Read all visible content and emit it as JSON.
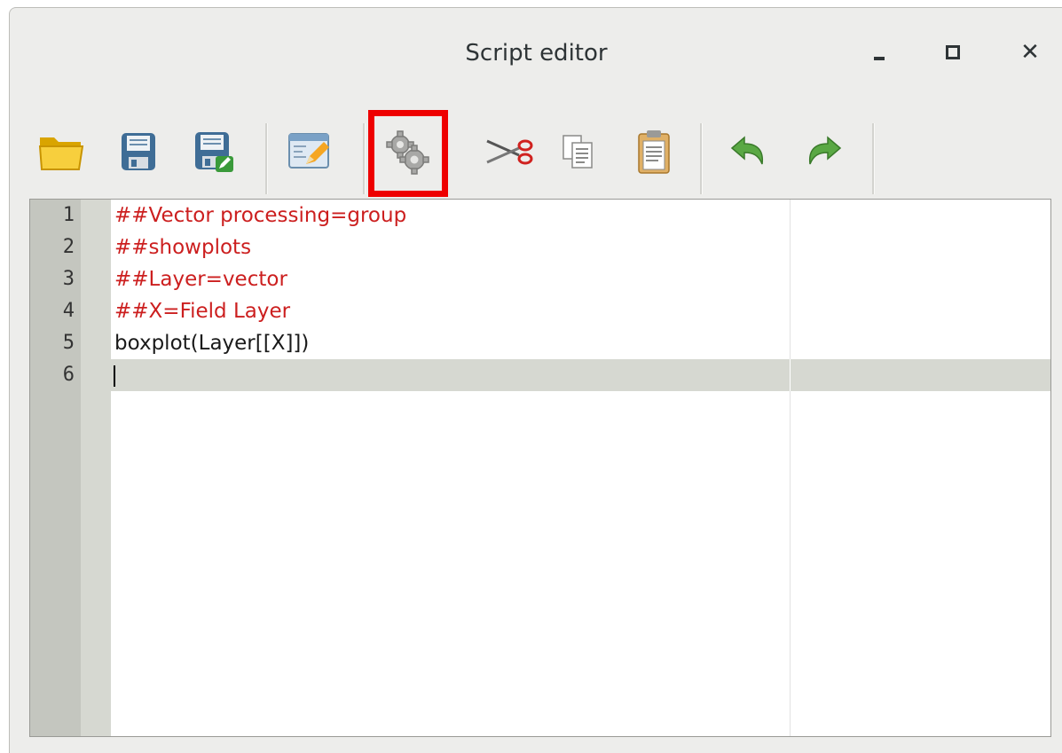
{
  "window": {
    "title": "Script editor"
  },
  "window_controls": {
    "minimize_icon": "minimize-icon",
    "maximize_icon": "maximize-icon",
    "close_icon": "close-icon",
    "close_glyph": "✕"
  },
  "toolbar": {
    "items": [
      {
        "icon": "open-folder-icon"
      },
      {
        "icon": "save-icon"
      },
      {
        "icon": "save-as-icon"
      },
      {
        "icon": "edit-script-help-icon"
      },
      {
        "icon": "run-algorithm-gears-icon",
        "highlighted": true
      },
      {
        "icon": "cut-scissors-icon"
      },
      {
        "icon": "copy-icon"
      },
      {
        "icon": "paste-icon"
      },
      {
        "icon": "undo-icon"
      },
      {
        "icon": "redo-icon"
      }
    ],
    "highlight_color": "#ee0000"
  },
  "editor": {
    "line_numbers": [
      "1",
      "2",
      "3",
      "4",
      "5",
      "6"
    ],
    "lines": [
      "##Vector processing=group",
      "##showplots",
      "##Layer=vector",
      "##X=Field Layer",
      "boxplot(Layer[[X]])",
      ""
    ],
    "current_line": 6,
    "comment_color": "#cc1f1f"
  }
}
